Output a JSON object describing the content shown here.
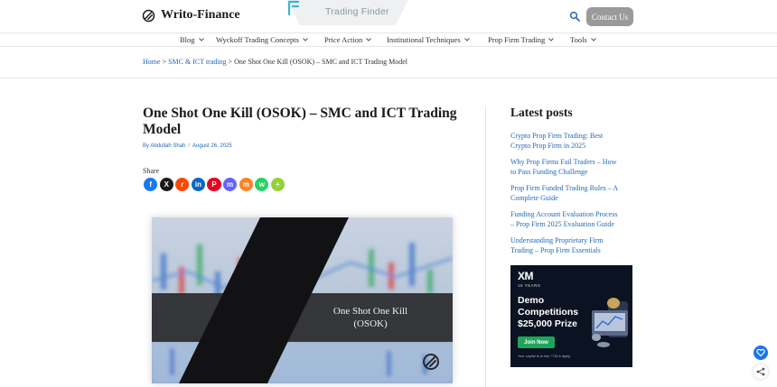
{
  "header": {
    "logo_text": "Writo-Finance",
    "badge_text": "Trading Finder",
    "search_icon": "search-icon",
    "contact_label": "Contact Us"
  },
  "nav": {
    "items": [
      {
        "label": "Blog"
      },
      {
        "label": "Wyckoff Trading Concepts"
      },
      {
        "label": "Price Action"
      },
      {
        "label": "Institutional Techniques"
      },
      {
        "label": "Prop Firm Trading"
      },
      {
        "label": "Tools"
      }
    ]
  },
  "breadcrumb": {
    "home": "Home",
    "sep1": " > ",
    "category": "SMC & ICT trading",
    "sep2": " > ",
    "current": "One Shot One Kill (OSOK) – SMC and ICT Trading Model"
  },
  "article": {
    "title": "One Shot One Kill (OSOK) – SMC and ICT Trading Model",
    "author": "By Abdullah Shah",
    "meta_sep": "/",
    "date": "August 26, 2025",
    "share_label": "Share",
    "share_buttons": [
      {
        "icon": "facebook-icon",
        "glyph": "f",
        "color": "#1877f2"
      },
      {
        "icon": "x-icon",
        "glyph": "X",
        "color": "#1a1a1a"
      },
      {
        "icon": "reddit-icon",
        "glyph": "r",
        "color": "#ff4500"
      },
      {
        "icon": "linkedin-icon",
        "glyph": "in",
        "color": "#0a66c2"
      },
      {
        "icon": "pinterest-icon",
        "glyph": "P",
        "color": "#e60023"
      },
      {
        "icon": "mastodon-icon",
        "glyph": "m",
        "color": "#6364ff"
      },
      {
        "icon": "mix-icon",
        "glyph": "m",
        "color": "#ff8226"
      },
      {
        "icon": "whatsapp-icon",
        "glyph": "w",
        "color": "#25d366"
      },
      {
        "icon": "more-icon",
        "glyph": "+",
        "color": "#95d03a"
      }
    ],
    "hero_caption_line1": "One Shot One Kill",
    "hero_caption_line2": "(OSOK)"
  },
  "sidebar": {
    "title": "Latest posts",
    "posts": [
      {
        "line1": "Crypto Prop Firm Trading: Best",
        "line2": "Crypto Prop Firm in 2025"
      },
      {
        "line1": "Why Prop Firms Fail Traders – How",
        "line2": "to Pass Funding Challenge"
      },
      {
        "line1": "Prop Firm Funded Trading Rules – A",
        "line2": "Complete Guide"
      },
      {
        "line1": "Funding Account Evaluation Process",
        "line2": "– Prop Firm 2025 Evaluation Guide"
      },
      {
        "line1": "Understanding Proprietary Firm",
        "line2": "Trading – Prop Firm Essentials"
      }
    ],
    "ad": {
      "brand": "XM",
      "years": "15 YEARS",
      "headline_line1": "Demo",
      "headline_line2": "Competitions",
      "headline_line3": "$25,000 Prize",
      "cta": "Join Now",
      "disclaimer": "Your capital is at risk. *T&Cs apply."
    }
  },
  "colors": {
    "link": "#2269b8",
    "contact_bg": "#9a9a9a",
    "ad_bg": "#0b1221",
    "ad_cta": "#1ea55b"
  }
}
